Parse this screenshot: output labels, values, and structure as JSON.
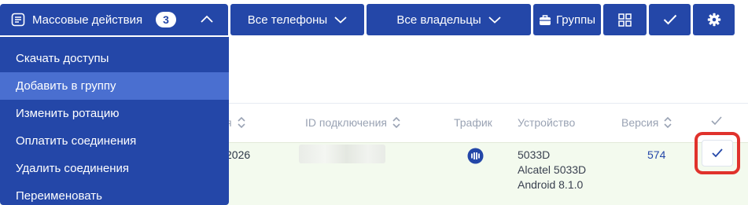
{
  "toolbar": {
    "mass_actions_label": "Массовые действия",
    "selected_count": "3",
    "phones_label": "Все телефоны",
    "owners_label": "Все владельцы",
    "groups_label": "Группы"
  },
  "dropdown": {
    "items": [
      "Скачать доступы",
      "Добавить в группу",
      "Изменить ротацию",
      "Оплатить соединения",
      "Удалить соединения",
      "Переименовать"
    ],
    "highlighted_index": 1
  },
  "table": {
    "headers": {
      "date_fragment": "я",
      "connection_id": "ID подключения",
      "traffic": "Трафик",
      "device": "Устройство",
      "version": "Версия"
    },
    "row": {
      "date_fragment": "2026",
      "device_lines": [
        "5033D",
        "Alcatel 5033D",
        "Android 8.1.0"
      ],
      "version": "574",
      "checked": true
    }
  },
  "colors": {
    "primary": "#2447a8",
    "menu_hover": "#4a6fd0",
    "row_selected": "#f3faee",
    "highlight_outline": "#e0322c"
  }
}
